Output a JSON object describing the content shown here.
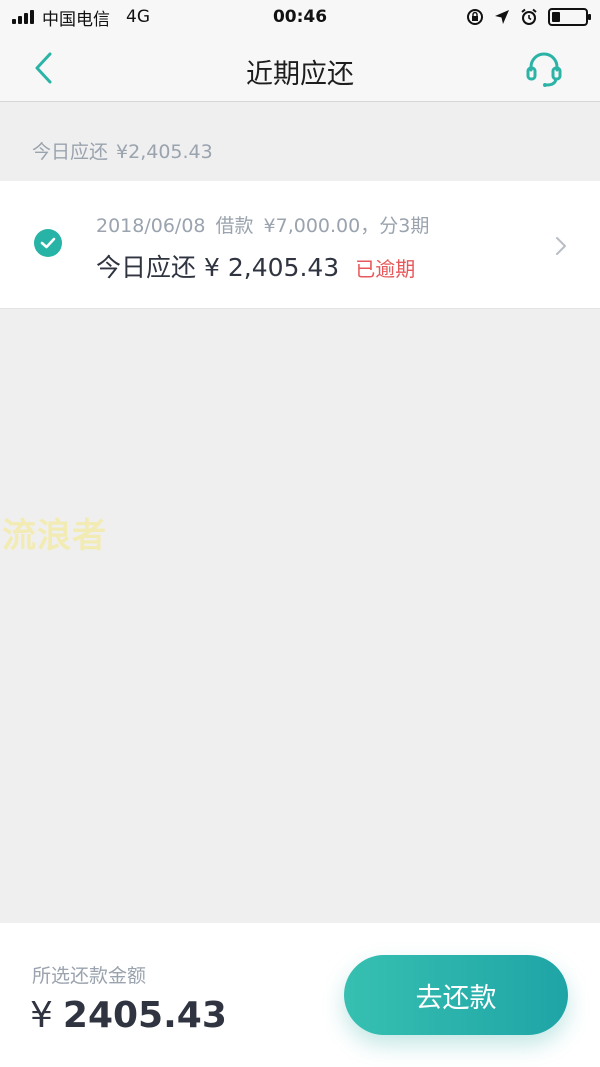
{
  "status_bar": {
    "carrier": "中国电信",
    "network": "4G",
    "time": "00:46",
    "battery_level": 0.25
  },
  "nav": {
    "title": "近期应还",
    "back_icon": "chevron-left-icon",
    "support_icon": "headset-icon"
  },
  "summary": {
    "label": "今日应还",
    "amount": "¥2,405.43"
  },
  "loan": {
    "date": "2018/06/08",
    "type": "借款",
    "principal": "¥7,000.00，",
    "installments": "分3期",
    "due_label": "今日应还",
    "due_amount": "¥ 2,405.43",
    "status": "已逾期",
    "selected": true
  },
  "watermark": "流浪者",
  "footer": {
    "selected_label": "所选还款金额",
    "currency": "¥",
    "selected_amount": "2405.43",
    "pay_button": "去还款"
  },
  "colors": {
    "accent": "#27b3a6",
    "overdue": "#e8585a",
    "muted_text": "#9aa3ae",
    "main_text": "#2f3440",
    "background": "#efefef"
  }
}
